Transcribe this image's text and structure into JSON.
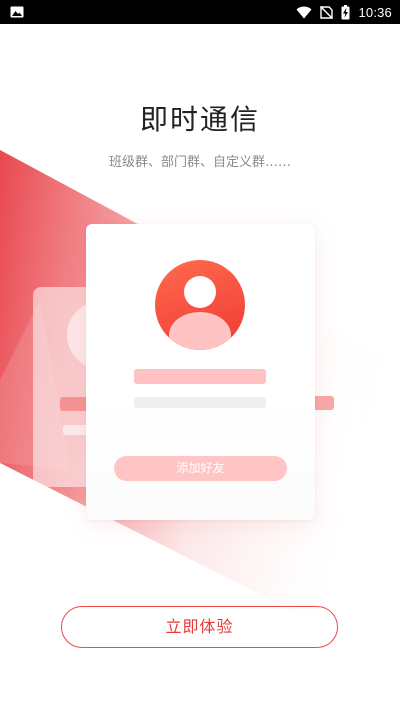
{
  "status_bar": {
    "time": "10:36",
    "left_icon": "image-icon",
    "icons": [
      "wifi-icon",
      "no-sim-icon",
      "battery-charging-icon"
    ]
  },
  "intro": {
    "title": "即时通信",
    "subtitle": "班级群、部门群、自定义群……"
  },
  "card": {
    "avatar_icon": "user-avatar-icon",
    "add_friend_label": "添加好友"
  },
  "cta": {
    "try_label": "立即体验"
  },
  "colors": {
    "accent": "#e83a3a",
    "avatar": "#ef3a35",
    "band": "#e8484f",
    "placeholder_pink": "#ffc1c1",
    "placeholder_gray": "#efefef"
  }
}
